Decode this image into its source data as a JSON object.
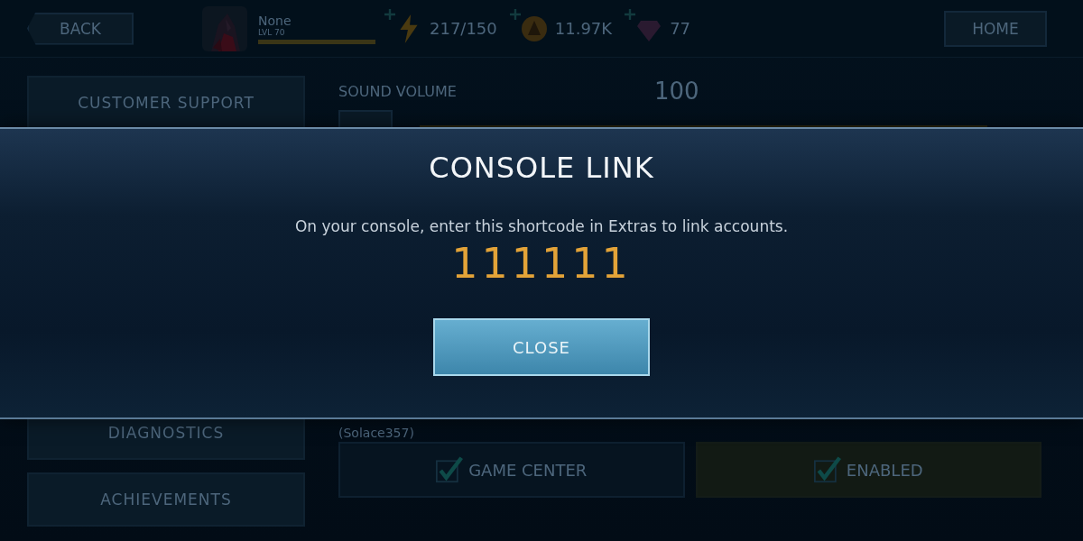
{
  "top_bar": {
    "back_button": "BACK",
    "player": {
      "name": "None",
      "level_label": "LVL 70",
      "xp": {
        "level": 1.0
      }
    },
    "currencies": [
      {
        "kind": "energy",
        "value": "217/150"
      },
      {
        "kind": "coin",
        "value": "11.97K"
      },
      {
        "kind": "gem",
        "value": "77"
      }
    ],
    "home_button": "HOME"
  },
  "sidebar": {
    "items": [
      {
        "label": "CUSTOMER SUPPORT"
      },
      {
        "label": "DIAGNOSTICS"
      },
      {
        "label": "ACHIEVEMENTS"
      }
    ]
  },
  "settings": {
    "sound_volume": {
      "label": "SOUND VOLUME",
      "value": "100",
      "level": 1.0
    },
    "account": "(Solace357)",
    "toggles": [
      {
        "label": "GAME CENTER",
        "checked": true,
        "selected": false
      },
      {
        "label": "ENABLED",
        "checked": true,
        "selected": true
      }
    ]
  },
  "dialog": {
    "title": "CONSOLE LINK",
    "message": "On your console, enter this shortcode in Extras to link accounts.",
    "code": "111111",
    "close_button": "CLOSE"
  }
}
